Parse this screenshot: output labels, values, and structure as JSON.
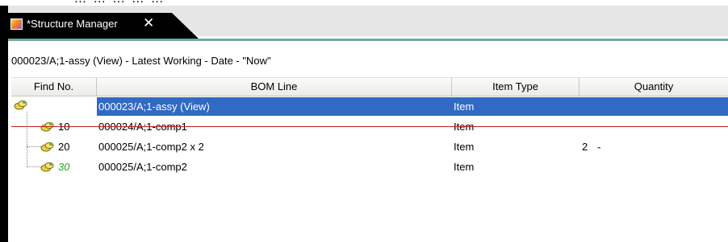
{
  "window": {
    "caption_cut": "…  …  …  …  …",
    "tab_label": "*Structure Manager",
    "tab_close_glyph": "✕"
  },
  "context": {
    "line": "000023/A;1-assy (View) - Latest Working - Date - \"Now\""
  },
  "columns": [
    "Find No.",
    "BOM Line",
    "Item Type",
    "Quantity"
  ],
  "rows": [
    {
      "find_no": "",
      "bom_line": "000023/A;1-assy (View)",
      "item_type": "Item",
      "quantity": "",
      "quantity_marker": "",
      "selected": true,
      "struck": false,
      "find_color": "#000000"
    },
    {
      "find_no": "10",
      "bom_line": "000024/A;1-comp1",
      "item_type": "Item",
      "quantity": "",
      "quantity_marker": "",
      "selected": false,
      "struck": true,
      "find_color": "#000000"
    },
    {
      "find_no": "20",
      "bom_line": "000025/A;1-comp2 x 2",
      "item_type": "Item",
      "quantity": "2",
      "quantity_marker": "-",
      "selected": false,
      "struck": false,
      "find_color": "#000000"
    },
    {
      "find_no": "30",
      "bom_line": "000025/A;1-comp2",
      "item_type": "Item",
      "quantity": "",
      "quantity_marker": "",
      "selected": false,
      "struck": false,
      "find_color": "#22aa22"
    }
  ],
  "colors": {
    "selection": "#316ac5",
    "strike": "#c0201c",
    "added_find_no": "#22aa22",
    "pane_border": "#6fa9a3"
  },
  "icons": {
    "app_tab": "structure-manager-app-icon",
    "bom_line": "bom-line-item-icon",
    "close": "close-icon"
  }
}
